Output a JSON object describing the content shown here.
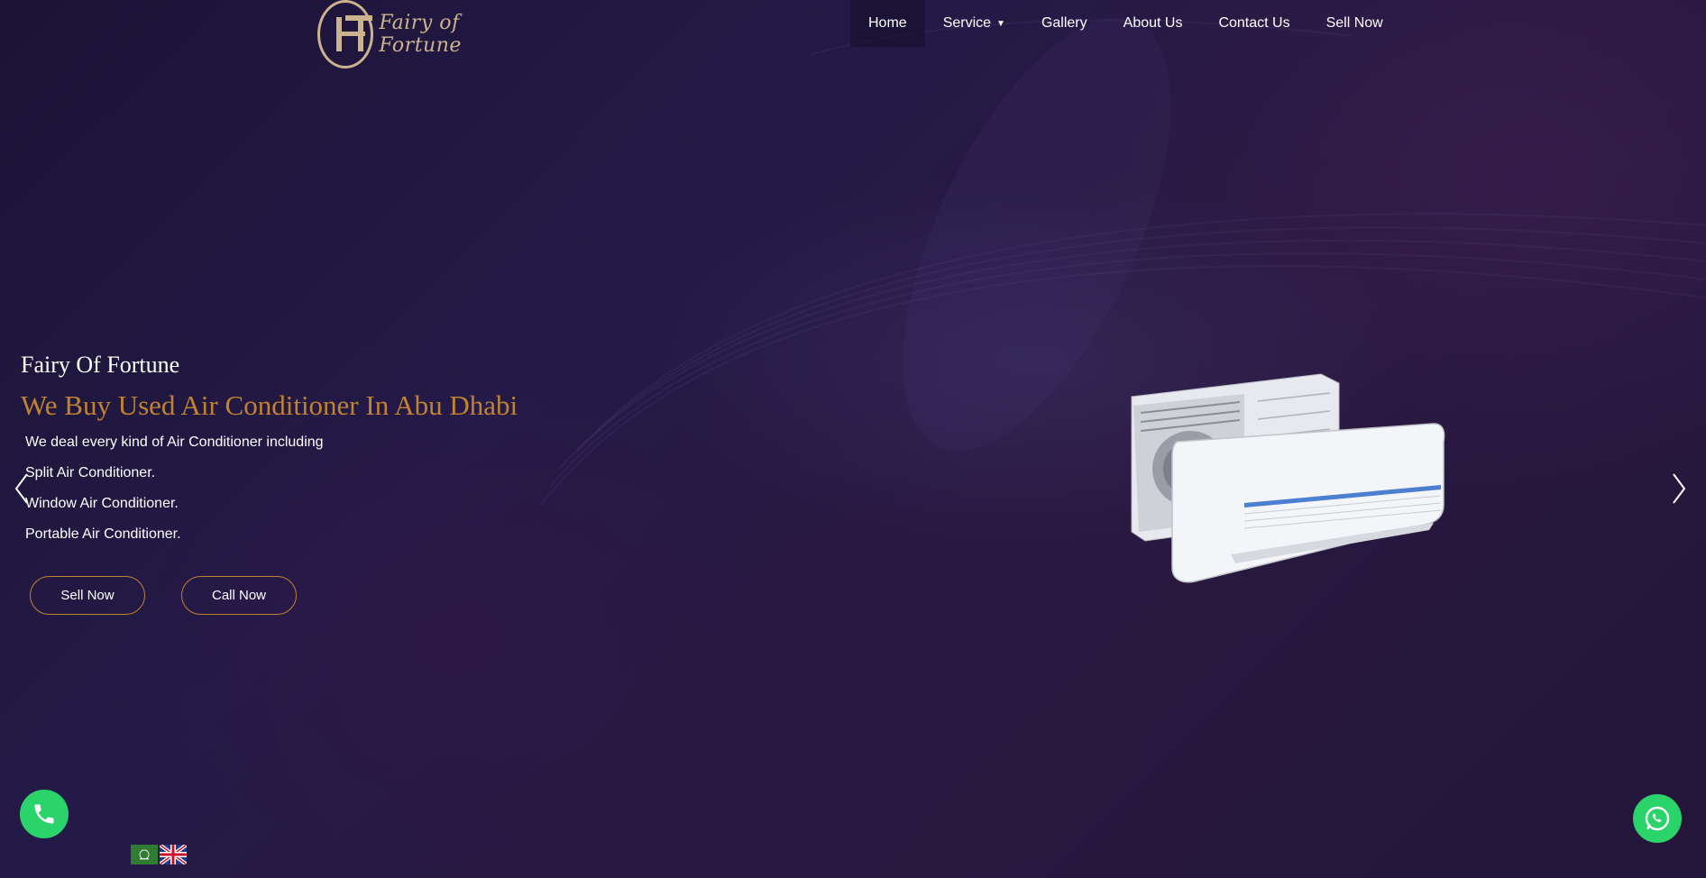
{
  "header": {
    "logo_text": "Fairy of Fortune",
    "nav": [
      {
        "label": "Home"
      },
      {
        "label": "Service"
      },
      {
        "label": "Gallery"
      },
      {
        "label": "About Us"
      },
      {
        "label": "Contact Us"
      },
      {
        "label": "Sell Now"
      }
    ]
  },
  "hero": {
    "brand": "Fairy Of Fortune",
    "headline": "We Buy Used Air Conditioner In Abu Dhabi",
    "description": "We deal every kind of Air Conditioner including",
    "items": [
      "Split Air Conditioner.",
      "Window Air Conditioner.",
      "Portable Air Conditioner."
    ],
    "sell_button": "Sell Now",
    "call_button": "Call Now"
  },
  "icons": {
    "prev": "chevron-left-icon",
    "next": "chevron-right-icon",
    "phone": "phone-icon",
    "whatsapp": "whatsapp-icon"
  },
  "colors": {
    "accent": "#c1832f",
    "logo": "#cdb28e",
    "floating_button": "#2bd46a"
  }
}
